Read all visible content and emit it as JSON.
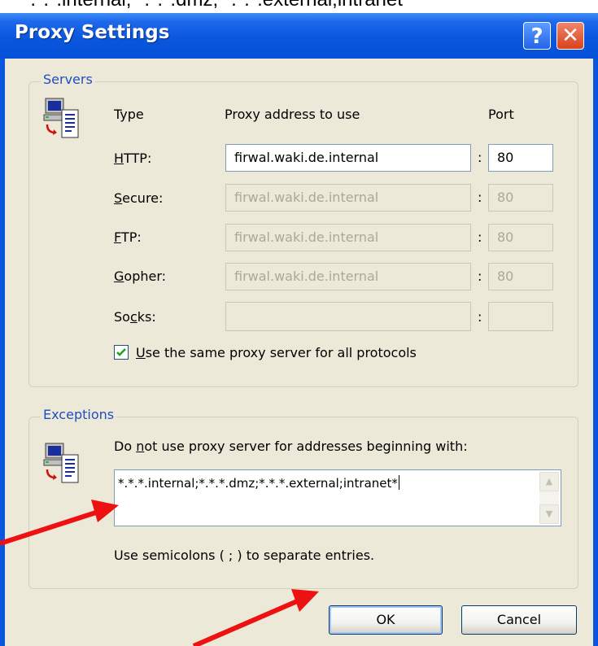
{
  "caption": "*.*.*.internal; *.*.*.dmz; *.*.*.external;intranet*",
  "window": {
    "title": "Proxy Settings",
    "help_glyph": "?",
    "close_glyph": "✕"
  },
  "servers": {
    "group_label": "Servers",
    "icon": "network-computer-icon",
    "headers": {
      "type": "Type",
      "address": "Proxy address to use",
      "port": "Port"
    },
    "rows": [
      {
        "pre": "",
        "key": "H",
        "post": "TTP:",
        "address": "firwal.waki.de.internal",
        "port": "80",
        "enabled": true
      },
      {
        "pre": "",
        "key": "S",
        "post": "ecure:",
        "address": "firwal.waki.de.internal",
        "port": "80",
        "enabled": false
      },
      {
        "pre": "",
        "key": "F",
        "post": "TP:",
        "address": "firwal.waki.de.internal",
        "port": "80",
        "enabled": false
      },
      {
        "pre": "",
        "key": "G",
        "post": "opher:",
        "address": "firwal.waki.de.internal",
        "port": "80",
        "enabled": false
      },
      {
        "pre": "So",
        "key": "c",
        "post": "ks:",
        "address": "",
        "port": "",
        "enabled": false
      }
    ],
    "colon": ":",
    "same_proxy": {
      "key": "U",
      "post": "se the same proxy server for all protocols",
      "checked": true
    }
  },
  "exceptions": {
    "group_label": "Exceptions",
    "icon": "network-computer-icon",
    "desc_pre": "Do ",
    "desc_key": "n",
    "desc_post": "ot use proxy server for addresses beginning with:",
    "value": "*.*.*.internal;*.*.*.dmz;*.*.*.external;intranet*",
    "hint": "Use semicolons ( ; ) to separate entries."
  },
  "buttons": {
    "ok": "OK",
    "cancel": "Cancel"
  },
  "colors": {
    "titlebar": "#0a55de",
    "dialog_bg": "#ece9d8",
    "group_label": "#1f4ec2",
    "arrow": "#ee1111"
  }
}
